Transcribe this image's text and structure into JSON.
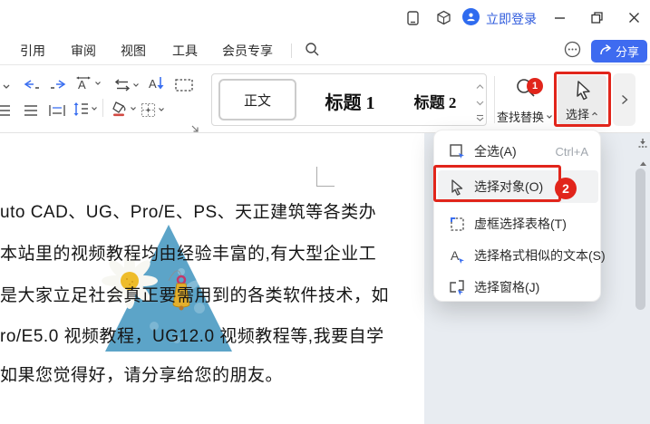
{
  "titlebar": {
    "login_label": "立即登录"
  },
  "menubar": {
    "tabs": [
      {
        "label": "引用"
      },
      {
        "label": "审阅"
      },
      {
        "label": "视图"
      },
      {
        "label": "工具"
      },
      {
        "label": "会员专享"
      }
    ],
    "share_label": "分享"
  },
  "ribbon": {
    "style_gallery": [
      {
        "label": "正文"
      },
      {
        "label": "标题 1"
      },
      {
        "label": "标题 2"
      }
    ],
    "find_replace_label": "查找替换",
    "select_label": "选择"
  },
  "annotations": {
    "step1": "1",
    "step2": "2"
  },
  "dropdown": {
    "items": [
      {
        "label": "全选(A)",
        "shortcut": "Ctrl+A"
      },
      {
        "label": "选择对象(O)"
      },
      {
        "label": "虚框选择表格(T)"
      },
      {
        "label": "选择格式相似的文本(S)"
      },
      {
        "label": "选择窗格(J)"
      }
    ]
  },
  "document": {
    "lines": [
      "uto CAD、UG、Pro/E、PS、天正建筑等各类办",
      "本站里的视频教程均由经验丰富的,有大型企业工",
      "是大家立足社会真正要需用到的各类软件技术，如",
      "ro/E5.0 视频教程，UG12.0 视频教程等,我要自学",
      "如果您觉得好，请分享给您的朋友。"
    ]
  },
  "colors": {
    "accent_blue": "#3e6bf0",
    "annotation_red": "#e1251b",
    "triangle_blue": "#5ca4c8"
  }
}
